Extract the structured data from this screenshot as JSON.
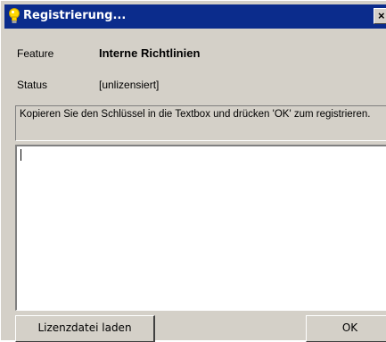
{
  "window": {
    "title": "Registrierung...",
    "close_glyph": "×",
    "icon": "lightbulb-icon"
  },
  "info": {
    "feature_label": "Feature",
    "feature_value": "Interne Richtlinien",
    "status_label": "Status",
    "status_value": "[unlizensiert]"
  },
  "instruction": "Kopieren Sie den Schlüssel in die Textbox und drücken 'OK' zum registrieren.",
  "license_textbox": {
    "value": ""
  },
  "buttons": {
    "load_license": "Lizenzdatei laden",
    "ok": "OK"
  },
  "colors": {
    "titlebar": "#0b2c8c",
    "dialog_bg": "#d4d0c8",
    "icon_yellow": "#ffd800"
  }
}
